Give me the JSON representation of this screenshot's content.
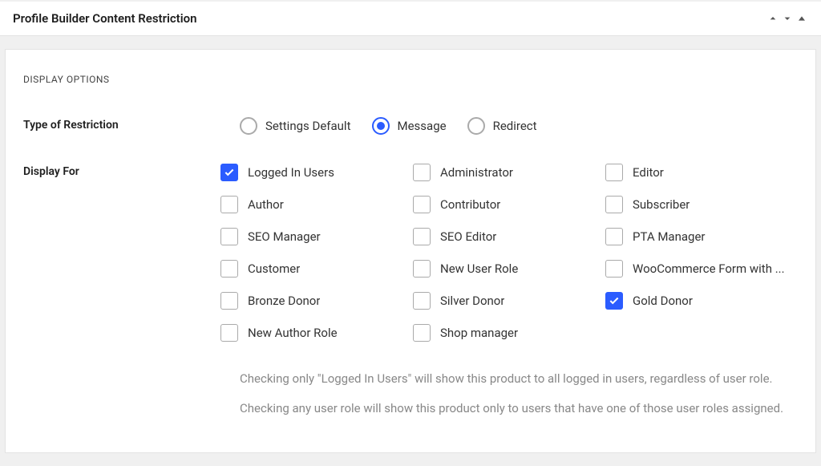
{
  "panel": {
    "title": "Profile Builder Content Restriction"
  },
  "section": {
    "title": "DISPLAY OPTIONS"
  },
  "restriction_type": {
    "label": "Type of Restriction",
    "options": [
      {
        "label": "Settings Default",
        "checked": false
      },
      {
        "label": "Message",
        "checked": true
      },
      {
        "label": "Redirect",
        "checked": false
      }
    ]
  },
  "display_for": {
    "label": "Display For",
    "options": [
      {
        "label": "Logged In Users",
        "checked": true
      },
      {
        "label": "Administrator",
        "checked": false
      },
      {
        "label": "Editor",
        "checked": false
      },
      {
        "label": "Author",
        "checked": false
      },
      {
        "label": "Contributor",
        "checked": false
      },
      {
        "label": "Subscriber",
        "checked": false
      },
      {
        "label": "SEO Manager",
        "checked": false
      },
      {
        "label": "SEO Editor",
        "checked": false
      },
      {
        "label": "PTA Manager",
        "checked": false
      },
      {
        "label": "Customer",
        "checked": false
      },
      {
        "label": "New User Role",
        "checked": false
      },
      {
        "label": "WooCommerce Form with ...",
        "checked": false
      },
      {
        "label": "Bronze Donor",
        "checked": false
      },
      {
        "label": "Silver Donor",
        "checked": false
      },
      {
        "label": "Gold Donor",
        "checked": true
      },
      {
        "label": "New Author Role",
        "checked": false
      },
      {
        "label": "Shop manager",
        "checked": false
      }
    ]
  },
  "help": {
    "text1": "Checking only \"Logged In Users\" will show this product to all logged in users, regardless of user role.",
    "text2": "Checking any user role will show this product only to users that have one of those user roles assigned."
  }
}
